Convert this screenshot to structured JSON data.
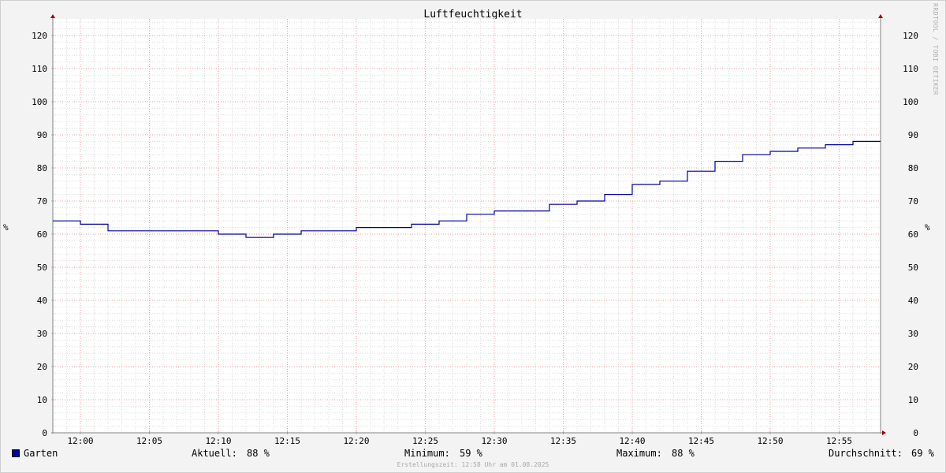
{
  "title": "Luftfeuchtigkeit",
  "watermark": "RRDTOOL / TOBI OETIKER",
  "legend": {
    "series_name": "Garten",
    "series_color": "#0000a0",
    "stats": [
      {
        "key": "aktuell",
        "label": "Aktuell:",
        "value": "88 %"
      },
      {
        "key": "minimum",
        "label": "Minimum:",
        "value": "59 %"
      },
      {
        "key": "maximum",
        "label": "Maximum:",
        "value": "88 %"
      },
      {
        "key": "durchschnitt",
        "label": "Durchschnitt:",
        "value": "69 %"
      }
    ]
  },
  "footer": "Erstellungszeit: 12:58 Uhr am 01.08.2025",
  "chart_data": {
    "type": "line",
    "step": true,
    "title": "Luftfeuchtigkeit",
    "ylabel": "%",
    "ylabel_right": "%",
    "ylim": [
      0,
      125
    ],
    "yticks": [
      0,
      10,
      20,
      30,
      40,
      50,
      60,
      70,
      80,
      90,
      100,
      110,
      120
    ],
    "xlim": [
      "11:58",
      "12:58"
    ],
    "xticks": [
      "12:00",
      "12:05",
      "12:10",
      "12:15",
      "12:20",
      "12:25",
      "12:30",
      "12:35",
      "12:40",
      "12:45",
      "12:50",
      "12:55"
    ],
    "grid": true,
    "series": [
      {
        "name": "Garten",
        "color": "#0000a0",
        "x": [
          "11:58",
          "12:00",
          "12:02",
          "12:04",
          "12:06",
          "12:08",
          "12:10",
          "12:12",
          "12:14",
          "12:16",
          "12:18",
          "12:20",
          "12:22",
          "12:24",
          "12:26",
          "12:28",
          "12:30",
          "12:32",
          "12:34",
          "12:36",
          "12:38",
          "12:40",
          "12:42",
          "12:44",
          "12:46",
          "12:48",
          "12:50",
          "12:52",
          "12:54",
          "12:56",
          "12:58"
        ],
        "values": [
          64,
          63,
          61,
          61,
          61,
          61,
          60,
          59,
          60,
          61,
          61,
          62,
          62,
          63,
          64,
          66,
          67,
          67,
          69,
          70,
          72,
          75,
          76,
          79,
          82,
          84,
          85,
          86,
          87,
          88,
          88
        ]
      }
    ]
  }
}
